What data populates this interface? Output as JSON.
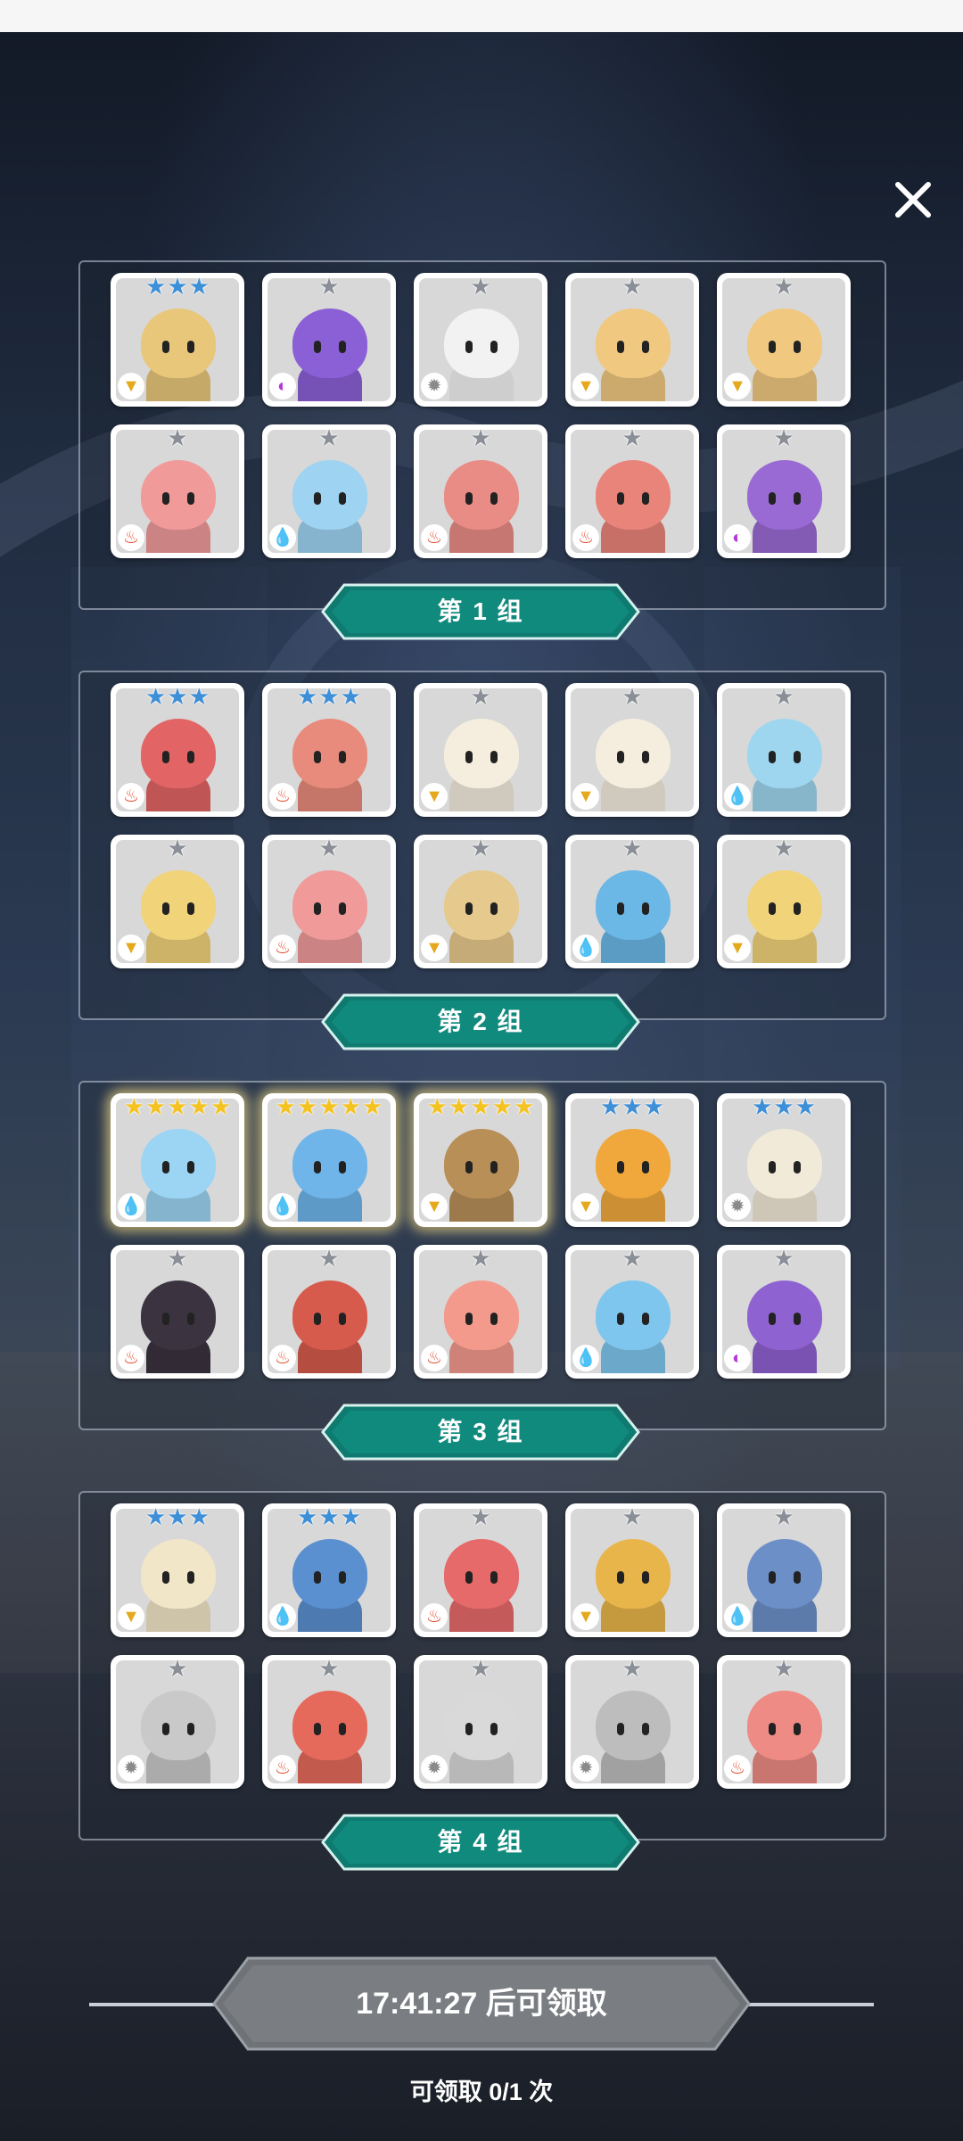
{
  "close_icon": "close-x-icon",
  "groups": [
    {
      "label": "第 1 组",
      "heroes": [
        {
          "stars": 3,
          "tier": "blue",
          "element": "earth",
          "color": "#e8c77a"
        },
        {
          "stars": 1,
          "tier": "gray",
          "element": "dark",
          "color": "#8b5fd6"
        },
        {
          "stars": 1,
          "tier": "gray",
          "element": "light",
          "color": "#f2f2f2"
        },
        {
          "stars": 1,
          "tier": "gray",
          "element": "earth",
          "color": "#f0c880"
        },
        {
          "stars": 1,
          "tier": "gray",
          "element": "earth",
          "color": "#f0c880"
        },
        {
          "stars": 1,
          "tier": "gray",
          "element": "fire",
          "color": "#f09a9a"
        },
        {
          "stars": 1,
          "tier": "gray",
          "element": "water",
          "color": "#9ed3f2"
        },
        {
          "stars": 1,
          "tier": "gray",
          "element": "fire",
          "color": "#e98c86"
        },
        {
          "stars": 1,
          "tier": "gray",
          "element": "fire",
          "color": "#e9847a"
        },
        {
          "stars": 1,
          "tier": "gray",
          "element": "dark",
          "color": "#9a6ad4"
        }
      ]
    },
    {
      "label": "第 2 组",
      "heroes": [
        {
          "stars": 3,
          "tier": "blue",
          "element": "fire",
          "color": "#e26464"
        },
        {
          "stars": 3,
          "tier": "blue",
          "element": "fire",
          "color": "#e88b7c"
        },
        {
          "stars": 1,
          "tier": "gray",
          "element": "earth",
          "color": "#f5eedf"
        },
        {
          "stars": 1,
          "tier": "gray",
          "element": "earth",
          "color": "#f5eedf"
        },
        {
          "stars": 1,
          "tier": "gray",
          "element": "water",
          "color": "#9fd6ef"
        },
        {
          "stars": 1,
          "tier": "gray",
          "element": "earth",
          "color": "#f1d37a"
        },
        {
          "stars": 1,
          "tier": "gray",
          "element": "fire",
          "color": "#f09a9a"
        },
        {
          "stars": 1,
          "tier": "gray",
          "element": "earth",
          "color": "#e6c98c"
        },
        {
          "stars": 1,
          "tier": "gray",
          "element": "water",
          "color": "#6bb7e6"
        },
        {
          "stars": 1,
          "tier": "gray",
          "element": "earth",
          "color": "#f1d37a"
        }
      ]
    },
    {
      "label": "第 3 组",
      "heroes": [
        {
          "stars": 5,
          "tier": "gold",
          "element": "water",
          "color": "#9cd4f3"
        },
        {
          "stars": 5,
          "tier": "gold",
          "element": "water",
          "color": "#6fb5ea"
        },
        {
          "stars": 5,
          "tier": "gold",
          "element": "earth",
          "color": "#b98f58"
        },
        {
          "stars": 3,
          "tier": "blue",
          "element": "earth",
          "color": "#f0a83c"
        },
        {
          "stars": 3,
          "tier": "blue",
          "element": "light",
          "color": "#f2ead9"
        },
        {
          "stars": 1,
          "tier": "gray",
          "element": "fire",
          "color": "#3b3340"
        },
        {
          "stars": 1,
          "tier": "gray",
          "element": "fire",
          "color": "#d65b4c"
        },
        {
          "stars": 1,
          "tier": "gray",
          "element": "fire",
          "color": "#f39a8d"
        },
        {
          "stars": 1,
          "tier": "gray",
          "element": "water",
          "color": "#7fc6ee"
        },
        {
          "stars": 1,
          "tier": "gray",
          "element": "dark",
          "color": "#8f62d1"
        }
      ]
    },
    {
      "label": "第 4 组",
      "heroes": [
        {
          "stars": 3,
          "tier": "blue",
          "element": "earth",
          "color": "#f1e6c8"
        },
        {
          "stars": 3,
          "tier": "blue",
          "element": "water",
          "color": "#5a8fd0"
        },
        {
          "stars": 1,
          "tier": "gray",
          "element": "fire",
          "color": "#e66a6a"
        },
        {
          "stars": 1,
          "tier": "gray",
          "element": "earth",
          "color": "#e8b54a"
        },
        {
          "stars": 1,
          "tier": "gray",
          "element": "water",
          "color": "#6c8fc8"
        },
        {
          "stars": 1,
          "tier": "gray",
          "element": "light",
          "color": "#c9c9c9"
        },
        {
          "stars": 1,
          "tier": "gray",
          "element": "fire",
          "color": "#e56a5c"
        },
        {
          "stars": 1,
          "tier": "gray",
          "element": "light",
          "color": "#d9d9d9"
        },
        {
          "stars": 1,
          "tier": "gray",
          "element": "light",
          "color": "#bdbdbd"
        },
        {
          "stars": 1,
          "tier": "gray",
          "element": "fire",
          "color": "#ee8b84"
        }
      ]
    }
  ],
  "element_glyphs": {
    "fire": "♨",
    "water": "💧",
    "earth": "▼",
    "light": "✹",
    "dark": "◐"
  },
  "element_colors": {
    "fire": "#e24a2c",
    "water": "#2b83d6",
    "earth": "#e4a91c",
    "light": "#8a8a8a",
    "dark": "#b43cd6"
  },
  "claim": {
    "button_label": "17:41:27 后可领取",
    "count_text": "可领取 0/1 次"
  }
}
